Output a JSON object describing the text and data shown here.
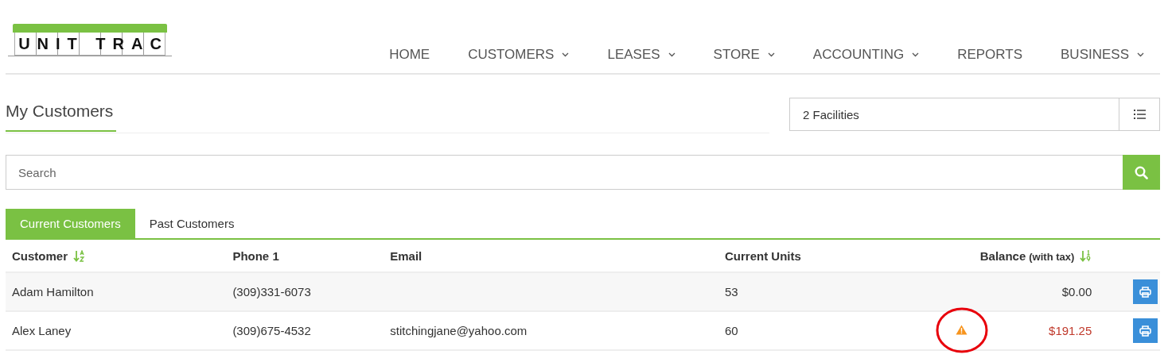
{
  "logo": {
    "text": "UNIT TRAC"
  },
  "nav": [
    {
      "label": "HOME",
      "dropdown": false
    },
    {
      "label": "CUSTOMERS",
      "dropdown": true
    },
    {
      "label": "LEASES",
      "dropdown": true
    },
    {
      "label": "STORE",
      "dropdown": true
    },
    {
      "label": "ACCOUNTING",
      "dropdown": true
    },
    {
      "label": "REPORTS",
      "dropdown": false
    },
    {
      "label": "BUSINESS",
      "dropdown": true
    }
  ],
  "page_title": "My Customers",
  "facility_select": {
    "value": "2 Facilities"
  },
  "search": {
    "placeholder": "Search"
  },
  "tabs": [
    {
      "label": "Current Customers",
      "selected": true
    },
    {
      "label": "Past Customers",
      "selected": false
    }
  ],
  "table": {
    "columns": [
      {
        "label": "Customer",
        "kind": "alpha-sorted"
      },
      {
        "label": "Phone 1",
        "kind": "plain"
      },
      {
        "label": "Email",
        "kind": "plain"
      },
      {
        "label": "Current Units",
        "kind": "plain"
      },
      {
        "label": "Balance",
        "note": "(with tax)",
        "kind": "numeric-sorted"
      }
    ],
    "rows": [
      {
        "customer": "Adam Hamilton",
        "phone": "(309)331-6073",
        "units": "53",
        "warning": false,
        "balance": "$0.00",
        "overdue": false
      },
      {
        "customer": "Alex Laney",
        "phone": "(309)675-4532",
        "email": "stitchingjane@yahoo.com",
        "units": "60",
        "warning": true,
        "balance": "$191.25",
        "overdue": true
      }
    ]
  }
}
